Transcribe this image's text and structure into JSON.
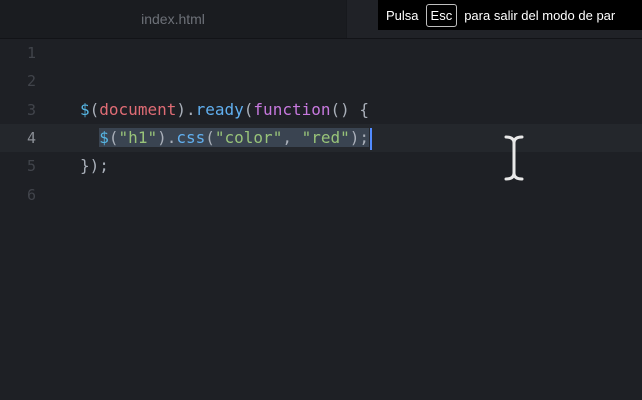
{
  "tab": {
    "filename": "index.html"
  },
  "fullscreen_notice": {
    "prefix": "Pulsa",
    "key": "Esc",
    "suffix": "para salir del modo de par"
  },
  "editor": {
    "line_numbers": [
      "1",
      "2",
      "3",
      "4",
      "5",
      "6"
    ],
    "active_line": "4",
    "lines": [
      [],
      [],
      [
        {
          "t": "$",
          "c": "dollar"
        },
        {
          "t": "(",
          "c": "punc"
        },
        {
          "t": "document",
          "c": "var"
        },
        {
          "t": ").",
          "c": "punc"
        },
        {
          "t": "ready",
          "c": "func"
        },
        {
          "t": "(",
          "c": "punc"
        },
        {
          "t": "function",
          "c": "kw"
        },
        {
          "t": "() {",
          "c": "punc"
        }
      ],
      [
        {
          "t": "  ",
          "c": "punc"
        },
        {
          "t": "$",
          "c": "dollar",
          "sel": true
        },
        {
          "t": "(",
          "c": "punc",
          "sel": true
        },
        {
          "t": "\"h1\"",
          "c": "str",
          "sel": true
        },
        {
          "t": ").",
          "c": "punc",
          "sel": true
        },
        {
          "t": "css",
          "c": "func",
          "sel": true
        },
        {
          "t": "(",
          "c": "punc",
          "sel": true
        },
        {
          "t": "\"color\"",
          "c": "str",
          "sel": true
        },
        {
          "t": ", ",
          "c": "punc",
          "sel": true
        },
        {
          "t": "\"red\"",
          "c": "str",
          "sel": true
        },
        {
          "t": ");",
          "c": "punc",
          "sel": true
        }
      ],
      [
        {
          "t": "});",
          "c": "punc"
        }
      ],
      []
    ]
  },
  "colors": {
    "background": "#1e2025",
    "selection": "#3a4451",
    "caret": "#528bff"
  },
  "cursor_icon": "text-cursor-ibeam-icon"
}
